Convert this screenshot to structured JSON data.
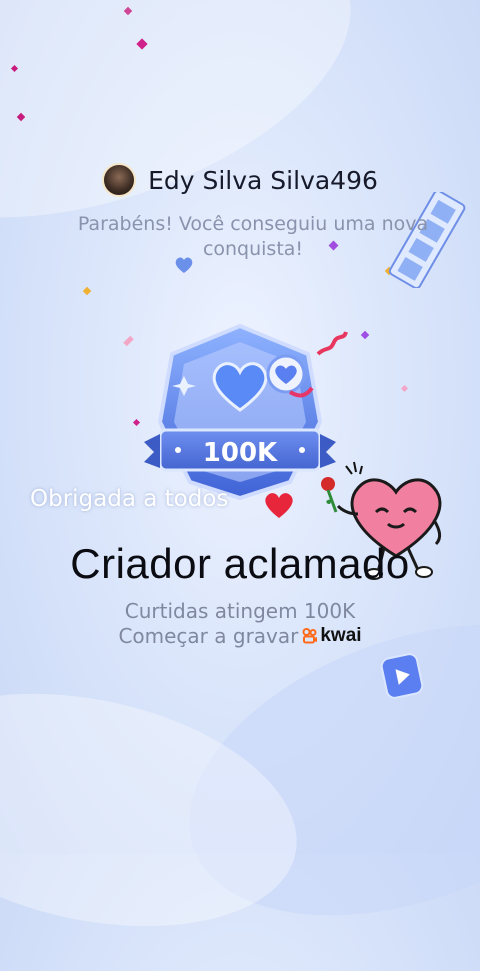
{
  "user": {
    "name": "Edy Silva Silva496"
  },
  "message": "Parabéns! Você conseguiu uma nova conquista!",
  "badge": {
    "label": "100K"
  },
  "caption": "Obrigada a todos",
  "title": "Criador aclamado",
  "subtitle": "Curtidas atingem 100K",
  "record": {
    "label": "Começar a gravar",
    "brand": "kwai"
  },
  "colors": {
    "accent": "#4d6ee0",
    "heart": "#e8263b",
    "confetti": "#d0208a"
  }
}
